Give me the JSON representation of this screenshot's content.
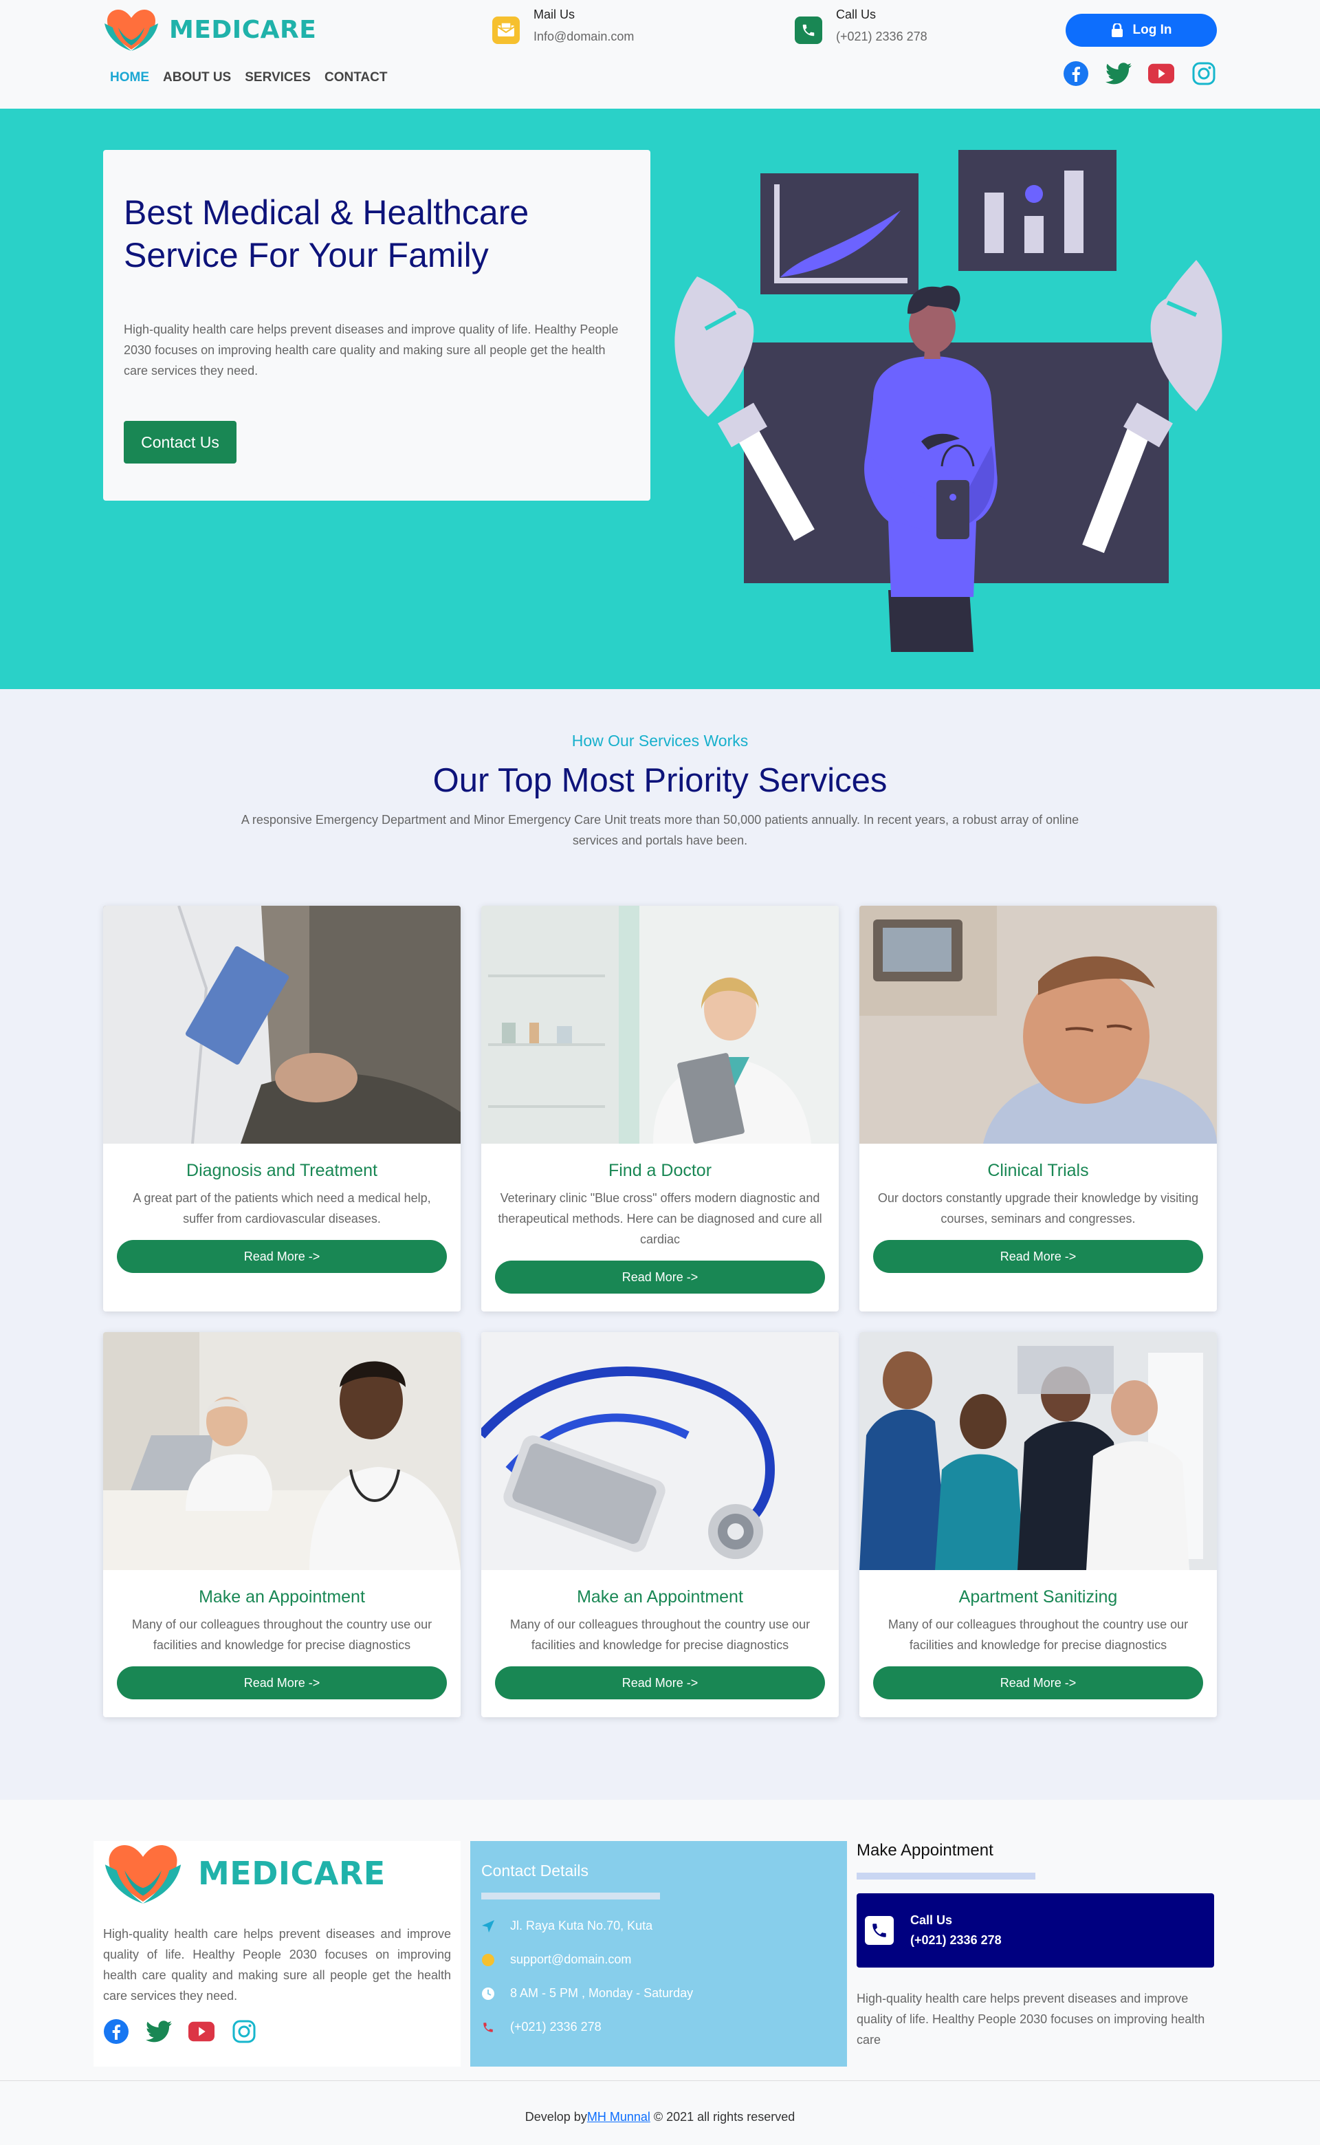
{
  "brand": {
    "name": "MEDICARE"
  },
  "header": {
    "mail": {
      "title": "Mail Us",
      "value": "Info@domain.com"
    },
    "call": {
      "title": "Call Us",
      "value": "(+021) 2336 278"
    },
    "login_label": "Log In",
    "nav": [
      "HOME",
      "ABOUT US",
      "SERVICES",
      "CONTACT"
    ],
    "socials": [
      "facebook-icon",
      "twitter-icon",
      "youtube-icon",
      "instagram-icon"
    ]
  },
  "hero": {
    "title_line1": "Best Medical & Healthcare",
    "title_line2": "Service For Your Family",
    "description": "High-quality health care helps prevent diseases and improve quality of life. Healthy People 2030 focuses on improving health care quality and making sure all people get the health care services they need.",
    "button": "Contact Us"
  },
  "services": {
    "subtitle": "How Our Services Works",
    "title": "Our Top Most Priority Services",
    "description": "A responsive Emergency Department and Minor Emergency Care Unit treats more than 50,000 patients annually. In recent years, a robust array of online services and portals have been.",
    "cards": [
      {
        "title": "Diagnosis and Treatment",
        "text": "A great part of the patients which need a medical help, suffer from cardiovascular diseases.",
        "button": "Read More ->"
      },
      {
        "title": "Find a Doctor",
        "text": "Veterinary clinic \"Blue cross\" offers modern diagnostic and therapeutical methods. Here can be diagnosed and cure all cardiac",
        "button": "Read More ->"
      },
      {
        "title": "Clinical Trials",
        "text": "Our doctors constantly upgrade their knowledge by visiting courses, seminars and congresses.",
        "button": "Read More ->"
      },
      {
        "title": "Make an Appointment",
        "text": "Many of our colleagues throughout the country use our facilities and knowledge for precise diagnostics",
        "button": "Read More ->"
      },
      {
        "title": "Make an Appointment",
        "text": "Many of our colleagues throughout the country use our facilities and knowledge for precise diagnostics",
        "button": "Read More ->"
      },
      {
        "title": "Apartment Sanitizing",
        "text": "Many of our colleagues throughout the country use our facilities and knowledge for precise diagnostics",
        "button": "Read More ->"
      }
    ]
  },
  "footer": {
    "description": "High-quality health care helps prevent diseases and improve quality of life. Healthy People 2030 focuses on improving health care quality and making sure all people get the health care services they need.",
    "contact": {
      "title": "Contact Details",
      "address": "Jl. Raya Kuta No.70, Kuta",
      "email": "support@domain.com",
      "hours": "8 AM - 5 PM , Monday - Saturday",
      "phone": "(+021) 2336 278"
    },
    "appointment": {
      "title": "Make Appointment",
      "call_title": "Call Us",
      "call_number": "(+021) 2336 278",
      "description": "High-quality health care helps prevent diseases and improve quality of life. Healthy People 2030 focuses on improving health care"
    },
    "copyright_prefix": "Develop by",
    "copyright_author": "MH Munnal",
    "copyright_suffix": " © 2021 all rights reserved"
  },
  "colors": {
    "teal": "#2ad1c8",
    "navy": "#0d137a",
    "green": "#198754",
    "blue": "#0d6efd",
    "sky": "#87ceeb"
  }
}
